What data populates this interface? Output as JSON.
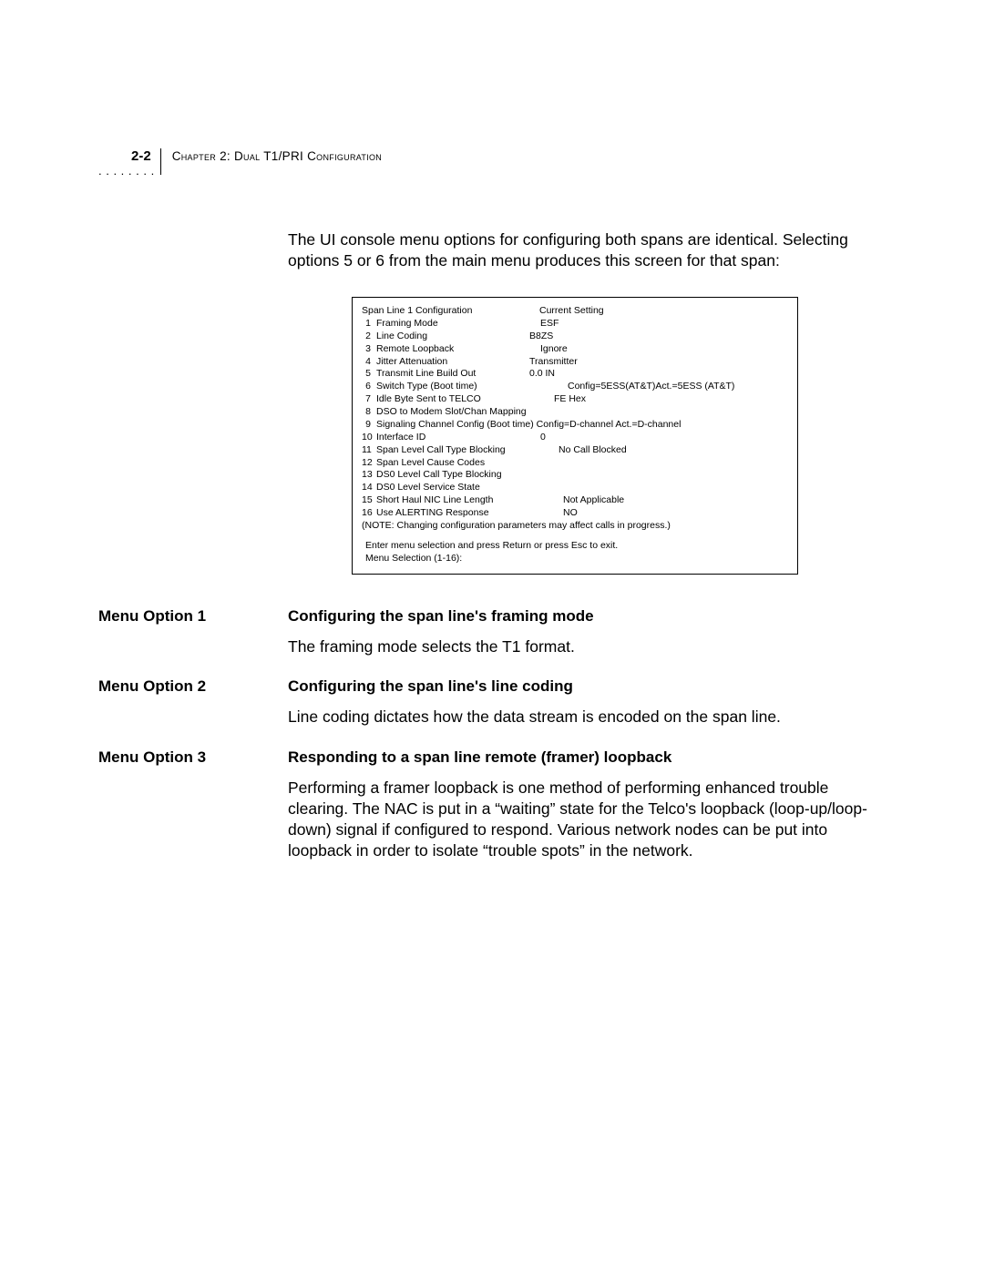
{
  "header": {
    "page_number": "2-2",
    "chapter": "Chapter 2: Dual T1/PRI Configuration",
    "dots": ". . . . . . . ."
  },
  "intro": "The UI console menu options for configuring both spans are identical. Selecting options 5 or 6 from the main menu produces this screen for that span:",
  "console": {
    "title_left": "Span Line 1 Configuration",
    "title_right": "Current Setting",
    "rows": [
      {
        "n": "1",
        "label": "Framing Mode",
        "setting": "ESF",
        "lw": 180
      },
      {
        "n": "2",
        "label": "Line Coding",
        "setting": "B8ZS",
        "lw": 168
      },
      {
        "n": "3",
        "label": "Remote Loopback",
        "setting": "Ignore",
        "lw": 180
      },
      {
        "n": "4",
        "label": "Jitter Attenuation",
        "setting": "Transmitter",
        "lw": 168
      },
      {
        "n": "5",
        "label": "Transmit Line Build Out",
        "setting": "0.0 IN",
        "lw": 168
      },
      {
        "n": "6",
        "label": "Switch Type (Boot time)",
        "setting": "Config=5ESS(AT&T)Act.=5ESS (AT&T)",
        "lw": 210
      },
      {
        "n": "7",
        "label": "Idle Byte Sent to TELCO",
        "setting": "FE Hex",
        "lw": 195
      },
      {
        "n": "8",
        "label": "DSO to Modem Slot/Chan Mapping",
        "setting": "",
        "lw": 230
      },
      {
        "n": "9",
        "label": "Signaling Channel Config (Boot time)  Config=D-channel Act.=D-channel",
        "setting": "",
        "lw": 400
      },
      {
        "n": "10",
        "label": "Interface ID",
        "setting": "0",
        "lw": 180
      },
      {
        "n": "11",
        "label": "Span Level Call Type Blocking",
        "setting": "No Call Blocked",
        "lw": 200
      },
      {
        "n": "12",
        "label": "Span Level Cause Codes",
        "setting": "",
        "lw": 200
      },
      {
        "n": "13",
        "label": "DS0 Level Call Type Blocking",
        "setting": "",
        "lw": 200
      },
      {
        "n": "14",
        "label": "DS0 Level Service State",
        "setting": "",
        "lw": 200
      },
      {
        "n": "15",
        "label": "Short Haul NIC Line Length",
        "setting": "Not Applicable",
        "lw": 205
      },
      {
        "n": "16",
        "label": "Use ALERTING Response",
        "setting": "NO",
        "lw": 205
      }
    ],
    "note": "(NOTE: Changing configuration parameters may affect calls in progress.)",
    "prompt": "Enter menu selection and press Return or press Esc to exit.",
    "selection": "Menu Selection (1-16):"
  },
  "options": [
    {
      "label": "Menu Option 1",
      "heading": "Configuring the span line's framing mode",
      "text": "The framing mode selects the T1 format."
    },
    {
      "label": "Menu Option 2",
      "heading": "Configuring the span line's line coding",
      "text": "Line coding dictates how the data stream is encoded on the span line."
    },
    {
      "label": "Menu Option 3",
      "heading": "Responding to a span line remote (framer) loopback",
      "text": "Performing a framer loopback is one method of performing enhanced trouble clearing. The NAC is put in a “waiting” state for the Telco's loopback (loop-up/loop-down) signal if configured to respond. Various network nodes can be put into loopback in order to isolate “trouble spots” in the network."
    }
  ]
}
